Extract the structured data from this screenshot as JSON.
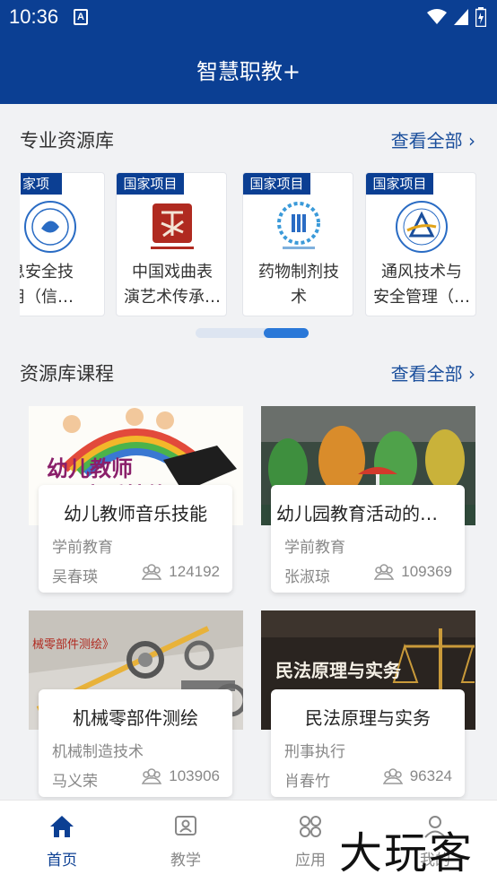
{
  "status_bar": {
    "time": "10:36",
    "notif_icon_text": "A"
  },
  "header": {
    "title": "智慧职教+"
  },
  "resource_section": {
    "title": "专业资源库",
    "more_label": "查看全部",
    "cards": [
      {
        "tag": "家项目",
        "name_line1": "言息安全技",
        "name_line2": "应用（信…"
      },
      {
        "tag": "国家项目",
        "name_line1": "中国戏曲表",
        "name_line2": "演艺术传承…"
      },
      {
        "tag": "国家项目",
        "name_line1": "药物制剂技",
        "name_line2": "术"
      },
      {
        "tag": "国家项目",
        "name_line1": "通风技术与",
        "name_line2": "安全管理（…"
      }
    ]
  },
  "course_section": {
    "title": "资源库课程",
    "more_label": "查看全部",
    "courses": [
      {
        "cover_text": "幼儿教师音乐技能",
        "name": "幼儿教师音乐技能",
        "category": "学前教育",
        "teacher": "吴春瑛",
        "views": "124192"
      },
      {
        "name": "幼儿园教育活动的…",
        "category": "学前教育",
        "teacher": "张淑琼",
        "views": "109369"
      },
      {
        "cover_text": "械零部件测绘》",
        "name": "机械零部件测绘",
        "category": "机械制造技术",
        "teacher": "马义荣",
        "views": "103906"
      },
      {
        "cover_text": "民法原理与实务",
        "name": "民法原理与实务",
        "category": "刑事执行",
        "teacher": "肖春竹",
        "views": "96324"
      }
    ]
  },
  "bottom_nav": {
    "items": [
      {
        "label": "首页",
        "icon": "home-icon",
        "active": true
      },
      {
        "label": "教学",
        "icon": "teach-icon",
        "active": false
      },
      {
        "label": "应用",
        "icon": "apps-icon",
        "active": false
      },
      {
        "label": "我的",
        "icon": "profile-icon",
        "active": false
      }
    ]
  },
  "watermark": "大玩客",
  "colors": {
    "primary": "#0b3f93",
    "link": "#1b4f9c",
    "accent": "#2a78d8"
  }
}
